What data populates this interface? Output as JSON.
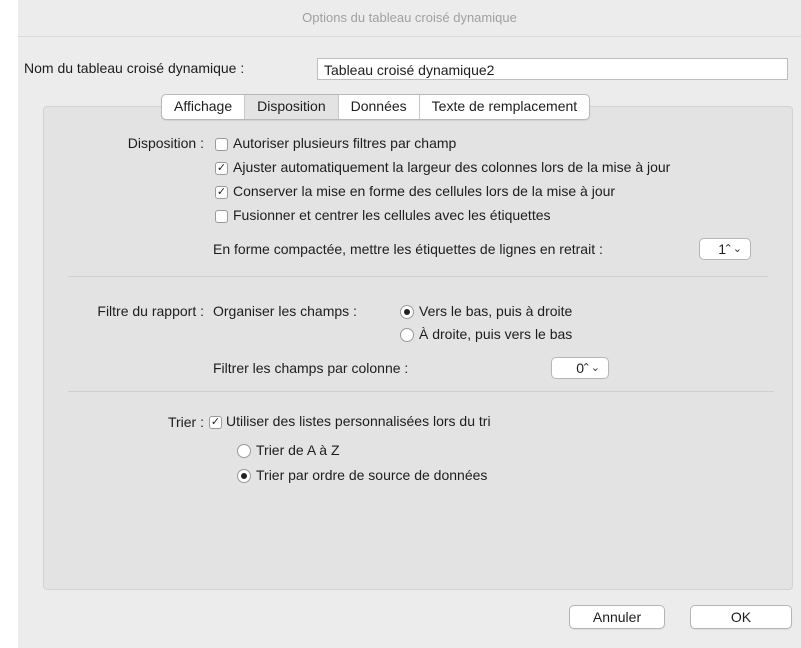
{
  "window": {
    "title": "Options du tableau croisé dynamique"
  },
  "name_field": {
    "label": "Nom du tableau croisé dynamique :",
    "value": "Tableau croisé dynamique2"
  },
  "tabs": [
    {
      "label": "Affichage",
      "active": false
    },
    {
      "label": "Disposition",
      "active": true
    },
    {
      "label": "Données",
      "active": false
    },
    {
      "label": "Texte de remplacement",
      "active": false
    }
  ],
  "disposition": {
    "label": "Disposition :",
    "options": [
      {
        "label": "Autoriser plusieurs filtres par champ",
        "checked": false
      },
      {
        "label": "Ajuster automatiquement la largeur des colonnes lors de la mise à jour",
        "checked": true
      },
      {
        "label": "Conserver la mise en forme des cellules lors de la mise à jour",
        "checked": true
      },
      {
        "label": "Fusionner et centrer les cellules avec les étiquettes",
        "checked": false
      }
    ],
    "indent_label": "En forme compactée, mettre les étiquettes de lignes en retrait :",
    "indent_value": "1"
  },
  "report_filter": {
    "label": "Filtre du rapport :",
    "arrange_label": "Organiser les champs :",
    "arrange_options": [
      {
        "label": "Vers le bas, puis à droite",
        "selected": true
      },
      {
        "label": "À droite, puis vers le bas",
        "selected": false
      }
    ],
    "per_column_label": "Filtrer les champs par colonne :",
    "per_column_value": "0"
  },
  "sort": {
    "label": "Trier :",
    "custom_lists_label": "Utiliser des listes personnalisées lors du tri",
    "custom_lists_checked": true,
    "options": [
      {
        "label": "Trier de A à Z",
        "selected": false
      },
      {
        "label": "Trier par ordre de source de données",
        "selected": true
      }
    ]
  },
  "buttons": {
    "cancel": "Annuler",
    "ok": "OK"
  },
  "glyphs": {
    "check": "✓",
    "stepper": "⌃⌄"
  }
}
